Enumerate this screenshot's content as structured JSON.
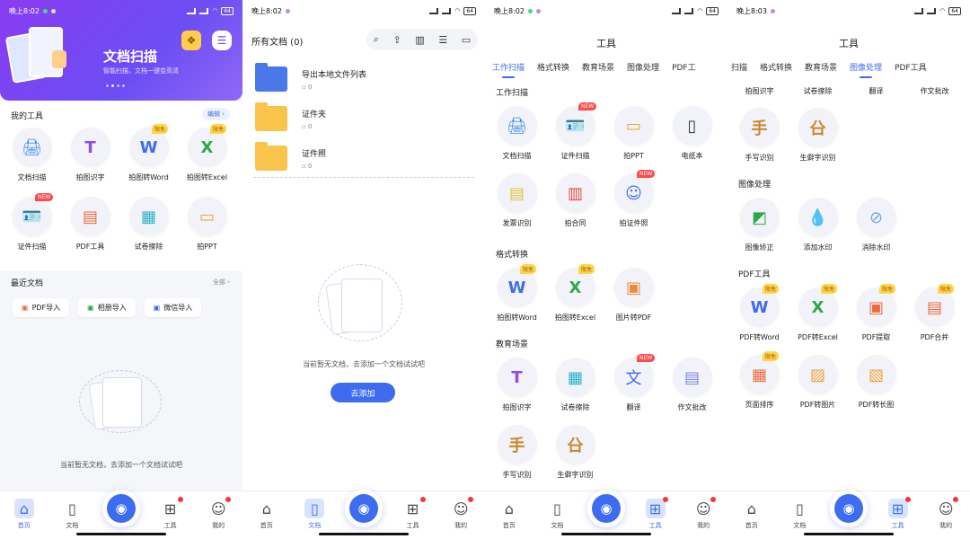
{
  "status": {
    "s1": {
      "time": "晚上8:02",
      "battery": "64"
    },
    "s2": {
      "time": "晚上8:02",
      "battery": "64"
    },
    "s3": {
      "time": "晚上8:02",
      "battery": "64"
    },
    "s4": {
      "time": "晚上8:03",
      "battery": "64"
    }
  },
  "nav": {
    "home": "首页",
    "docs": "文档",
    "tools": "工具",
    "mine": "我的"
  },
  "home": {
    "hero_title": "文档扫描",
    "hero_subtitle": "智能扫描，文档一键变高清",
    "my_tools_title": "我的工具",
    "edit_label": "编辑",
    "tools": [
      {
        "label": "文档扫描",
        "icon": "printer-icon",
        "badge": ""
      },
      {
        "label": "拍图识字",
        "icon": "text-t-icon",
        "badge": ""
      },
      {
        "label": "拍图转Word",
        "icon": "word-icon",
        "badge": "限免"
      },
      {
        "label": "拍图转Excel",
        "icon": "excel-icon",
        "badge": "限免"
      },
      {
        "label": "证件扫描",
        "icon": "id-card-icon",
        "badge": "NEW"
      },
      {
        "label": "PDF工具",
        "icon": "pdf-stack-icon",
        "badge": ""
      },
      {
        "label": "试卷擦除",
        "icon": "exam-icon",
        "badge": ""
      },
      {
        "label": "拍PPT",
        "icon": "ppt-icon",
        "badge": ""
      }
    ],
    "recent_title": "最近文档",
    "all_label": "全部",
    "imports": [
      {
        "label": "PDF导入"
      },
      {
        "label": "相册导入"
      },
      {
        "label": "微信导入"
      }
    ],
    "empty_text": "当前暂无文档，去添加一个文档试试吧"
  },
  "docs": {
    "title": "所有文档 (0)",
    "folders": [
      {
        "name": "导出本地文件列表",
        "count": "0"
      },
      {
        "name": "证件夹",
        "count": "0"
      },
      {
        "name": "证件照",
        "count": "0"
      }
    ],
    "empty_text": "当前暂无文档，去添加一个文档试试吧",
    "add_label": "去添加"
  },
  "tools_page": {
    "title": "工具",
    "tabs_a": [
      "工作扫描",
      "格式转换",
      "教育场景",
      "图像处理",
      "PDF工"
    ],
    "tabs_b": [
      "扫描",
      "格式转换",
      "教育场景",
      "图像处理",
      "PDF工具"
    ],
    "cats": {
      "work": "工作扫描",
      "format": "格式转换",
      "edu": "教育场景",
      "image": "图像处理",
      "pdf": "PDF工具"
    },
    "work_items": [
      {
        "label": "文档扫描",
        "badge": ""
      },
      {
        "label": "证件扫描",
        "badge": "NEW"
      },
      {
        "label": "拍PPT",
        "badge": ""
      },
      {
        "label": "电纸本",
        "badge": ""
      },
      {
        "label": "发票识别",
        "badge": ""
      },
      {
        "label": "拍合同",
        "badge": ""
      },
      {
        "label": "拍证件照",
        "badge": "NEW"
      }
    ],
    "format_items": [
      {
        "label": "拍图转Word",
        "badge": "限免"
      },
      {
        "label": "拍图转Excel",
        "badge": "限免"
      },
      {
        "label": "图片转PDF",
        "badge": ""
      }
    ],
    "edu_items": [
      {
        "label": "拍图识字",
        "badge": ""
      },
      {
        "label": "试卷擦除",
        "badge": ""
      },
      {
        "label": "翻译",
        "badge": "NEW"
      },
      {
        "label": "作文批改",
        "badge": ""
      },
      {
        "label": "手写识别",
        "badge": ""
      },
      {
        "label": "生僻字识别",
        "badge": ""
      }
    ],
    "top_row": [
      "拍图识字",
      "试卷擦除",
      "翻译",
      "作文批改"
    ],
    "edu_tail": [
      {
        "label": "手写识别"
      },
      {
        "label": "生僻字识别"
      }
    ],
    "image_items": [
      {
        "label": "图像矫正"
      },
      {
        "label": "添加水印"
      },
      {
        "label": "消除水印"
      }
    ],
    "pdf_items": [
      {
        "label": "PDF转Word",
        "badge": "限免"
      },
      {
        "label": "PDF转Excel",
        "badge": "限免"
      },
      {
        "label": "PDF提取",
        "badge": "限免"
      },
      {
        "label": "PDF合并",
        "badge": "限免"
      },
      {
        "label": "页面排序",
        "badge": "限免"
      },
      {
        "label": "PDF转图片",
        "badge": ""
      },
      {
        "label": "PDF转长图",
        "badge": ""
      }
    ]
  },
  "colors": {
    "accent": "#3d6cf0",
    "hero": "#7a45f3",
    "new_badge": "#ff4a4a",
    "free_badge": "#ffd54a"
  }
}
